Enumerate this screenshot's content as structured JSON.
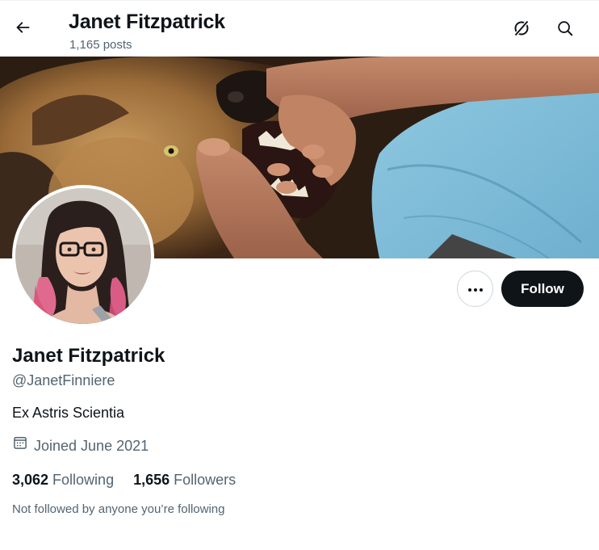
{
  "header": {
    "title": "Janet Fitzpatrick",
    "post_count": "1,165 posts",
    "back_icon": "arrow-left-icon",
    "grok_icon": "grok-icon",
    "search_icon": "search-icon"
  },
  "profile": {
    "name": "Janet Fitzpatrick",
    "handle": "@JanetFinniere",
    "bio": "Ex Astris Scientia",
    "joined": "Joined June 2021",
    "joined_icon": "calendar-icon",
    "following_count": "3,062",
    "following_label": "Following",
    "followers_count": "1,656",
    "followers_label": "Followers",
    "not_followed_text": "Not followed by anyone you’re following"
  },
  "actions": {
    "more_icon": "more-dots-icon",
    "follow_label": "Follow"
  },
  "colors": {
    "text_primary": "#0f1419",
    "text_secondary": "#536471",
    "follow_bg": "#0f1419",
    "border": "#cfd9de"
  }
}
